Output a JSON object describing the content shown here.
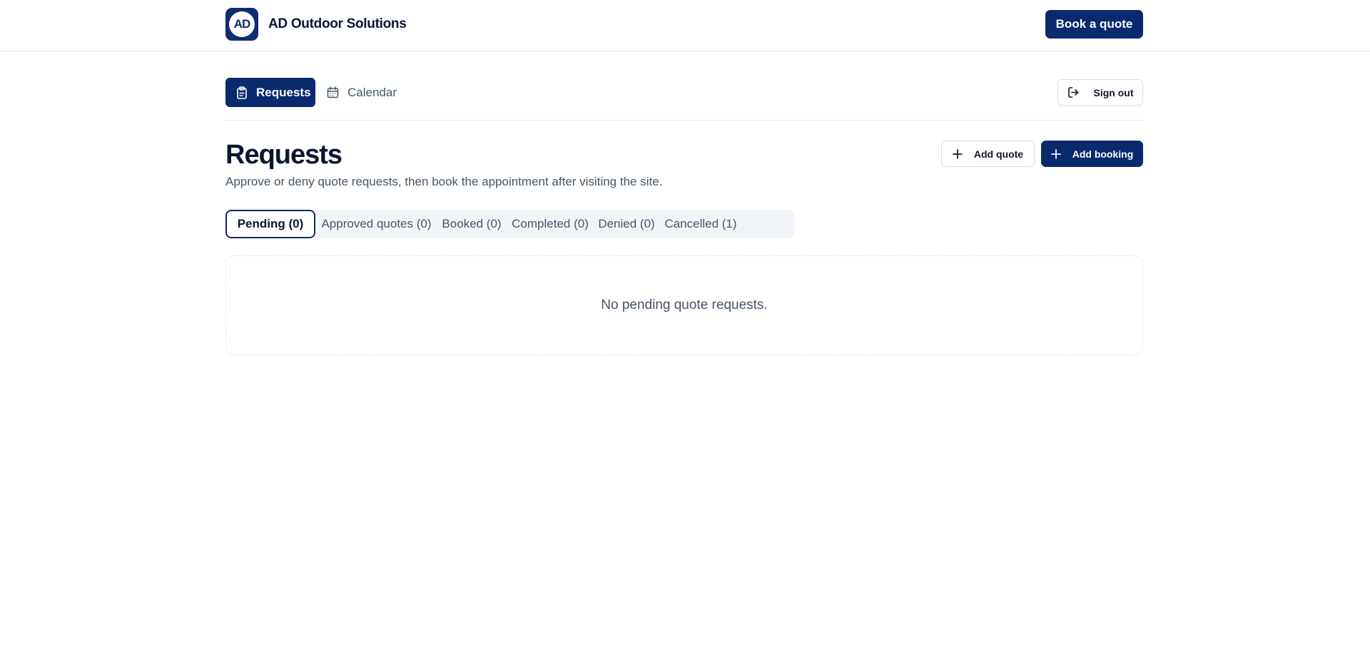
{
  "header": {
    "logo_text": "AD",
    "brand_name": "AD Outdoor Solutions",
    "book_quote_label": "Book a quote"
  },
  "nav": {
    "tabs": [
      {
        "label": "Requests",
        "icon": "clipboard-icon",
        "active": true
      },
      {
        "label": "Calendar",
        "icon": "calendar-icon",
        "active": false
      }
    ],
    "sign_out_label": "Sign out"
  },
  "main": {
    "title": "Requests",
    "subtitle": "Approve or deny quote requests, then book the appointment after visiting the site.",
    "add_quote_label": "Add quote",
    "add_booking_label": "Add booking",
    "status_tabs": [
      {
        "label": "Pending (0)",
        "active": true
      },
      {
        "label": "Approved quotes (0)",
        "active": false
      },
      {
        "label": "Booked (0)",
        "active": false
      },
      {
        "label": "Completed (0)",
        "active": false
      },
      {
        "label": "Denied (0)",
        "active": false
      },
      {
        "label": "Cancelled (1)",
        "active": false
      }
    ],
    "empty_message": "No pending quote requests."
  },
  "colors": {
    "primary": "#0a2a6e",
    "border": "#e2e8f0",
    "muted_text": "#475569",
    "tab_track": "#f1f5f9"
  }
}
